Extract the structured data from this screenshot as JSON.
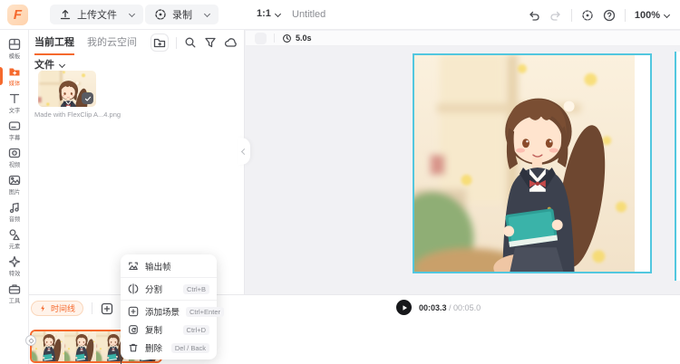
{
  "app": {
    "logo": "F"
  },
  "topbar": {
    "upload_label": "上传文件",
    "record_label": "录制",
    "ratio": "1:1",
    "title": "Untitled",
    "zoom": "100%"
  },
  "sidebar": {
    "items": [
      {
        "label": "模板",
        "icon": "template-icon",
        "active": false
      },
      {
        "label": "媒体",
        "icon": "media-folder-icon",
        "active": true
      },
      {
        "label": "文字",
        "icon": "text-icon",
        "active": false
      },
      {
        "label": "字幕",
        "icon": "subtitle-icon",
        "active": false
      },
      {
        "label": "视频",
        "icon": "video-icon",
        "active": false
      },
      {
        "label": "图片",
        "icon": "photo-icon",
        "active": false
      },
      {
        "label": "音频",
        "icon": "audio-icon",
        "active": false
      },
      {
        "label": "元素",
        "icon": "elements-icon",
        "active": false
      },
      {
        "label": "特效",
        "icon": "effects-icon",
        "active": false
      },
      {
        "label": "工具",
        "icon": "tools-icon",
        "active": false
      }
    ]
  },
  "media_panel": {
    "tab_current": "当前工程",
    "tab_cloud": "我的云空间",
    "files_label": "文件",
    "item_caption": "Made with FlexClip A...4.png"
  },
  "scene_bar": {
    "duration": "5.0s"
  },
  "context_menu": {
    "items": [
      {
        "label": "输出帧",
        "shortcut": ""
      },
      {
        "label": "分割",
        "shortcut": "Ctrl+B"
      },
      {
        "label": "添加场景",
        "shortcut": "Ctrl+Enter"
      },
      {
        "label": "复制",
        "shortcut": "Ctrl+D"
      },
      {
        "label": "删除",
        "shortcut": "Del / Back"
      }
    ]
  },
  "timeline": {
    "mode_label": "时间线"
  },
  "playback": {
    "current": "00:03.3",
    "total": "/ 00:05.0"
  },
  "colors": {
    "accent": "#F5692D",
    "selection": "#52C7DF"
  }
}
